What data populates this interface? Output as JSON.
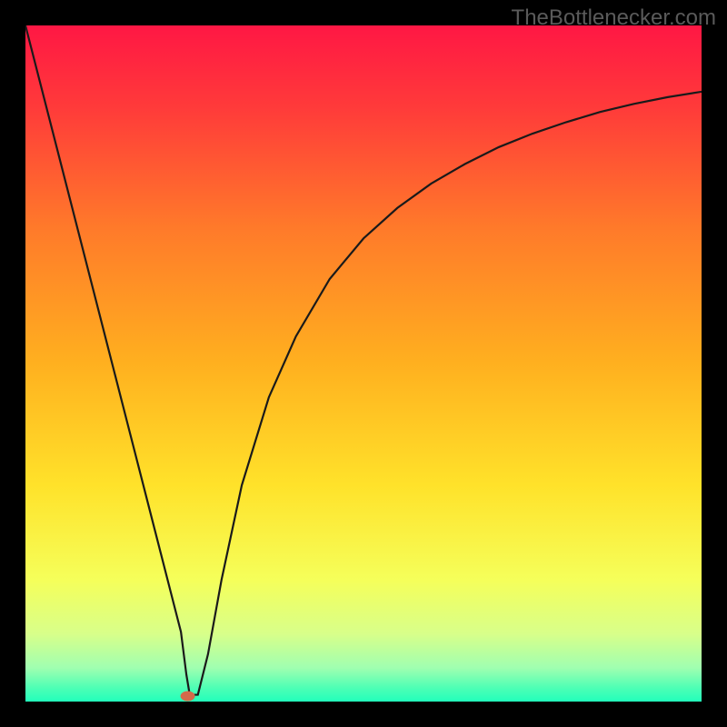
{
  "watermark": "TheBottlenecker.com",
  "chart_data": {
    "type": "line",
    "title": "",
    "xlabel": "",
    "ylabel": "",
    "xlim": [
      0,
      100
    ],
    "ylim": [
      0,
      100
    ],
    "background": {
      "type": "vertical-gradient",
      "stops": [
        {
          "pos": 0,
          "color": "#ff1744"
        },
        {
          "pos": 12,
          "color": "#ff3a3a"
        },
        {
          "pos": 30,
          "color": "#ff7a2a"
        },
        {
          "pos": 50,
          "color": "#ffb01f"
        },
        {
          "pos": 68,
          "color": "#ffe22a"
        },
        {
          "pos": 82,
          "color": "#f5ff5a"
        },
        {
          "pos": 90,
          "color": "#d8ff8a"
        },
        {
          "pos": 95,
          "color": "#a0ffb0"
        },
        {
          "pos": 98,
          "color": "#4dffb5"
        },
        {
          "pos": 100,
          "color": "#22ffbb"
        }
      ]
    },
    "curve": {
      "x": [
        0,
        5,
        10,
        15,
        18,
        20,
        22,
        23,
        23.8,
        24.3,
        25.5,
        27,
        29,
        32,
        36,
        40,
        45,
        50,
        55,
        60,
        65,
        70,
        75,
        80,
        85,
        90,
        95,
        100
      ],
      "y": [
        100,
        80.5,
        61,
        41.5,
        29.8,
        22,
        14.2,
        10.3,
        4,
        1,
        1,
        7,
        18,
        32,
        45,
        54,
        62.5,
        68.5,
        73,
        76.6,
        79.5,
        82,
        84,
        85.7,
        87.2,
        88.4,
        89.4,
        90.2
      ]
    },
    "marker": {
      "x": 24,
      "y": 0.8,
      "color": "#d46a4a",
      "rx": 8,
      "ry": 5.5
    }
  },
  "colors": {
    "border": "#000000",
    "curve_stroke": "#1a1a1a"
  }
}
